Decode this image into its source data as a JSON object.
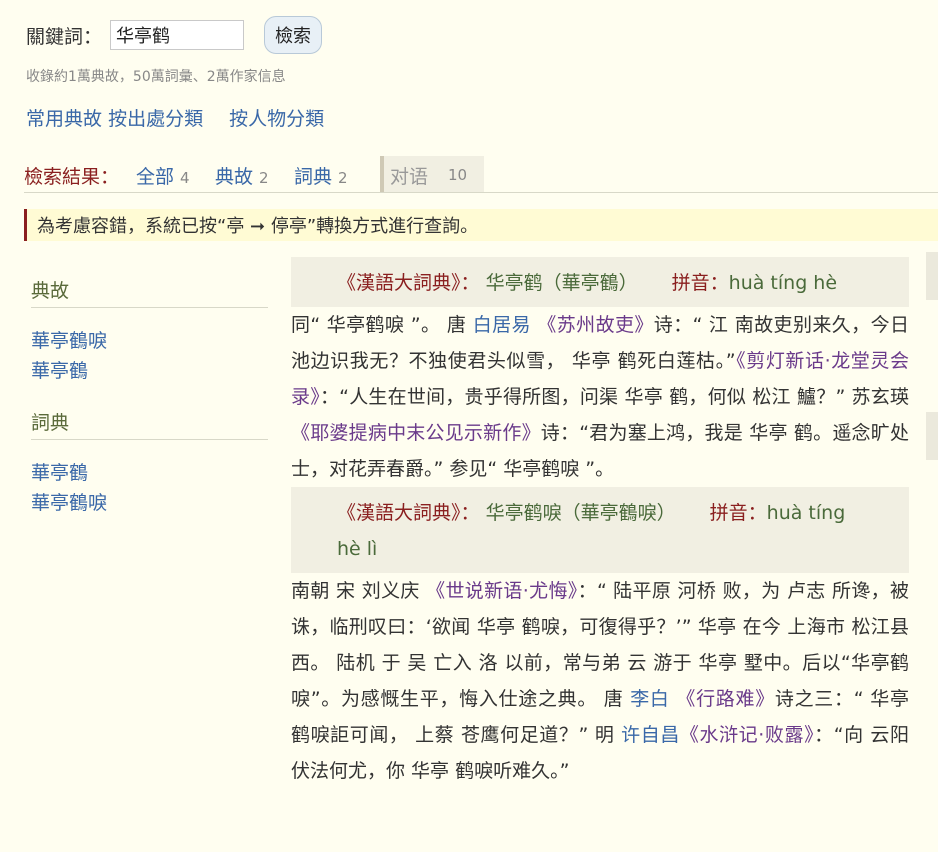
{
  "search": {
    "label": "關鍵詞：",
    "value": "华亭鹤",
    "button": "檢索",
    "stats": "收錄約1萬典故，50萬詞彙、2萬作家信息"
  },
  "categories": {
    "common": "常用典故",
    "by_source": "按出處分類",
    "by_person": "按人物分類"
  },
  "results": {
    "label": "檢索結果：",
    "tabs": [
      {
        "label": "全部",
        "count": "4"
      },
      {
        "label": "典故",
        "count": "2"
      },
      {
        "label": "詞典",
        "count": "2"
      },
      {
        "label": "对语",
        "count": "10"
      }
    ]
  },
  "notice": "為考慮容錯，系統已按“亭 ➞ 停亭”轉換方式進行查詢。",
  "sidebar": {
    "groups": [
      {
        "title": "典故",
        "items": [
          "華亭鶴唳",
          "華亭鶴"
        ]
      },
      {
        "title": "詞典",
        "items": [
          "華亭鶴",
          "華亭鶴唳"
        ]
      }
    ]
  },
  "entries": [
    {
      "source": "《漢語大詞典》",
      "colon": "：",
      "headword": "华亭鹤（華亭鶴）",
      "pinyin_label": "拼音：",
      "pinyin": "huà tíng hè",
      "body": [
        {
          "t": "同“ 华亭鹤唳 ”。 唐 ",
          "c": ""
        },
        {
          "t": "白居易",
          "c": "person"
        },
        {
          "t": " ",
          "c": ""
        },
        {
          "t": "《苏州故吏》",
          "c": "book"
        },
        {
          "t": "诗：“ 江 南故吏别来久，今日池边识我无？不独使君头似雪， 华亭 鹤死白莲枯。”",
          "c": ""
        },
        {
          "t": "《剪灯新话·龙堂灵会录》",
          "c": "book"
        },
        {
          "t": "：“人生在世间，贵乎得所图，问渠 华亭 鹤，何似 松江 鱸？” 苏玄瑛 ",
          "c": ""
        },
        {
          "t": "《耶婆提病中末公见示新作》",
          "c": "book"
        },
        {
          "t": "诗：“君为塞上鸿，我是 华亭 鹤。遥念旷处士，对花弄春爵。” 参见“ 华亭鹤唳 ”。",
          "c": ""
        }
      ]
    },
    {
      "source": "《漢語大詞典》",
      "colon": "：",
      "headword": "华亭鹤唳（華亭鶴唳）",
      "pinyin_label": "拼音：",
      "pinyin": "huà tíng hè lì",
      "body": [
        {
          "t": "南朝 宋 刘义庆 ",
          "c": ""
        },
        {
          "t": "《世说新语·尤悔》",
          "c": "book"
        },
        {
          "t": "：“ 陆平原 河桥 败，为 卢志 所谗，被诛，临刑叹曰：‘欲闻 华亭 鹤唳，可復得乎？’” 华亭 在今 上海市 松江县 西。 陆机 于 吴 亡入 洛 以前，常与弟 云 游于 华亭 墅中。后以“华亭鹤唳”。为感慨生平，悔入仕途之典。 唐 ",
          "c": ""
        },
        {
          "t": "李白",
          "c": "person"
        },
        {
          "t": " ",
          "c": ""
        },
        {
          "t": "《行路难》",
          "c": "book"
        },
        {
          "t": "诗之三：“ 华亭 鹤唳詎可闻， 上蔡 苍鹰何足道？” 明 ",
          "c": ""
        },
        {
          "t": "许自昌",
          "c": "person"
        },
        {
          "t": "《水浒记·败露》",
          "c": "book"
        },
        {
          "t": "：“向 云阳 伏法何尤，你 华亭 鹤唳听难久。”",
          "c": ""
        }
      ]
    }
  ]
}
